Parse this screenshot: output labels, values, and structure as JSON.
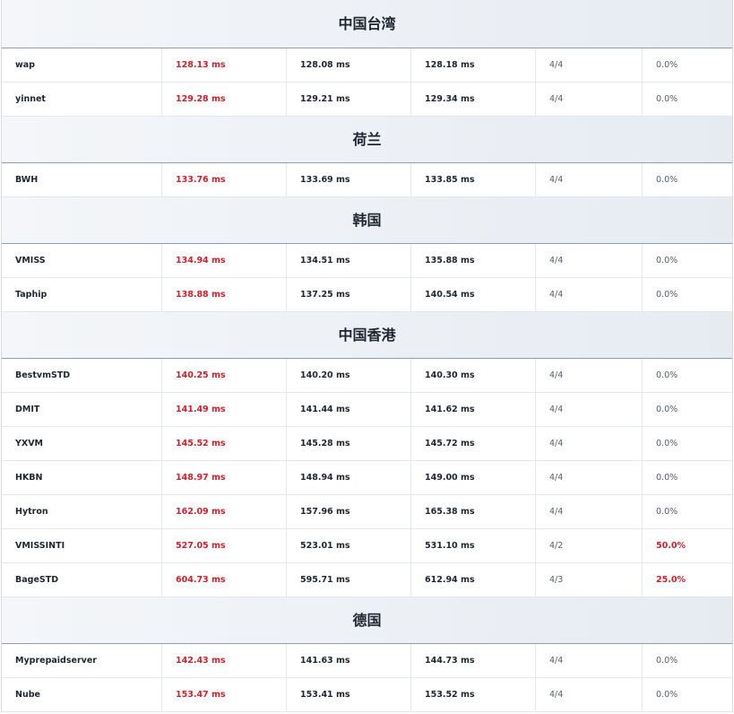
{
  "groups": [
    {
      "region": "中国台湾",
      "rows": [
        {
          "name": "wap",
          "avg": "128.13 ms",
          "min": "128.08 ms",
          "max": "128.18 ms",
          "recv": "4/4",
          "loss": "0.0%"
        },
        {
          "name": "yinnet",
          "avg": "129.28 ms",
          "min": "129.21 ms",
          "max": "129.34 ms",
          "recv": "4/4",
          "loss": "0.0%"
        }
      ]
    },
    {
      "region": "荷兰",
      "rows": [
        {
          "name": "BWH",
          "avg": "133.76 ms",
          "min": "133.69 ms",
          "max": "133.85 ms",
          "recv": "4/4",
          "loss": "0.0%"
        }
      ]
    },
    {
      "region": "韩国",
      "rows": [
        {
          "name": "VMISS",
          "avg": "134.94 ms",
          "min": "134.51 ms",
          "max": "135.88 ms",
          "recv": "4/4",
          "loss": "0.0%"
        },
        {
          "name": "Taphip",
          "avg": "138.88 ms",
          "min": "137.25 ms",
          "max": "140.54 ms",
          "recv": "4/4",
          "loss": "0.0%"
        }
      ]
    },
    {
      "region": "中国香港",
      "rows": [
        {
          "name": "BestvmSTD",
          "avg": "140.25 ms",
          "min": "140.20 ms",
          "max": "140.30 ms",
          "recv": "4/4",
          "loss": "0.0%"
        },
        {
          "name": "DMIT",
          "avg": "141.49 ms",
          "min": "141.44 ms",
          "max": "141.62 ms",
          "recv": "4/4",
          "loss": "0.0%"
        },
        {
          "name": "YXVM",
          "avg": "145.52 ms",
          "min": "145.28 ms",
          "max": "145.72 ms",
          "recv": "4/4",
          "loss": "0.0%"
        },
        {
          "name": "HKBN",
          "avg": "148.97 ms",
          "min": "148.94 ms",
          "max": "149.00 ms",
          "recv": "4/4",
          "loss": "0.0%"
        },
        {
          "name": "Hytron",
          "avg": "162.09 ms",
          "min": "157.96 ms",
          "max": "165.38 ms",
          "recv": "4/4",
          "loss": "0.0%"
        },
        {
          "name": "VMISSINTI",
          "avg": "527.05 ms",
          "min": "523.01 ms",
          "max": "531.10 ms",
          "recv": "4/2",
          "loss": "50.0%",
          "loss_alert": true
        },
        {
          "name": "BageSTD",
          "avg": "604.73 ms",
          "min": "595.71 ms",
          "max": "612.94 ms",
          "recv": "4/3",
          "loss": "25.0%",
          "loss_alert": true
        }
      ]
    },
    {
      "region": "德国",
      "rows": [
        {
          "name": "Myprepaidserver",
          "avg": "142.43 ms",
          "min": "141.63 ms",
          "max": "144.73 ms",
          "recv": "4/4",
          "loss": "0.0%"
        },
        {
          "name": "Nube",
          "avg": "153.47 ms",
          "min": "153.41 ms",
          "max": "153.52 ms",
          "recv": "4/4",
          "loss": "0.0%"
        }
      ]
    }
  ],
  "colors": {
    "avg_text": "#d0202a",
    "loss_alert": "#d0202a",
    "header_bg_left": "#f4f6f9",
    "header_bg_right": "#e6ebf2",
    "text_dark": "#1e2430"
  }
}
